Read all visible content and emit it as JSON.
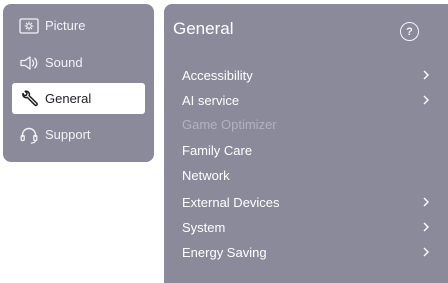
{
  "sidebar": {
    "items": [
      {
        "label": "Picture",
        "icon": "picture-icon"
      },
      {
        "label": "Sound",
        "icon": "speaker-icon"
      },
      {
        "label": "General",
        "icon": "wrench-icon",
        "active": true
      },
      {
        "label": "Support",
        "icon": "headset-icon"
      }
    ]
  },
  "main": {
    "title": "General",
    "help_glyph": "?",
    "items": [
      {
        "label": "Accessibility",
        "has_arrow": true
      },
      {
        "label": "AI service",
        "has_arrow": true
      },
      {
        "label": "Game Optimizer",
        "has_arrow": false,
        "disabled": true
      },
      {
        "label": "Family Care",
        "has_arrow": false
      },
      {
        "label": "Network",
        "has_arrow": false
      },
      {
        "label": "External Devices",
        "has_arrow": true
      },
      {
        "label": "System",
        "has_arrow": true
      },
      {
        "label": "Energy Saving",
        "has_arrow": true
      }
    ]
  },
  "colors": {
    "panel": "#8b8a9b",
    "active_bg": "#ffffff",
    "text": "#ffffff",
    "disabled_text": "#b3b2bf"
  }
}
